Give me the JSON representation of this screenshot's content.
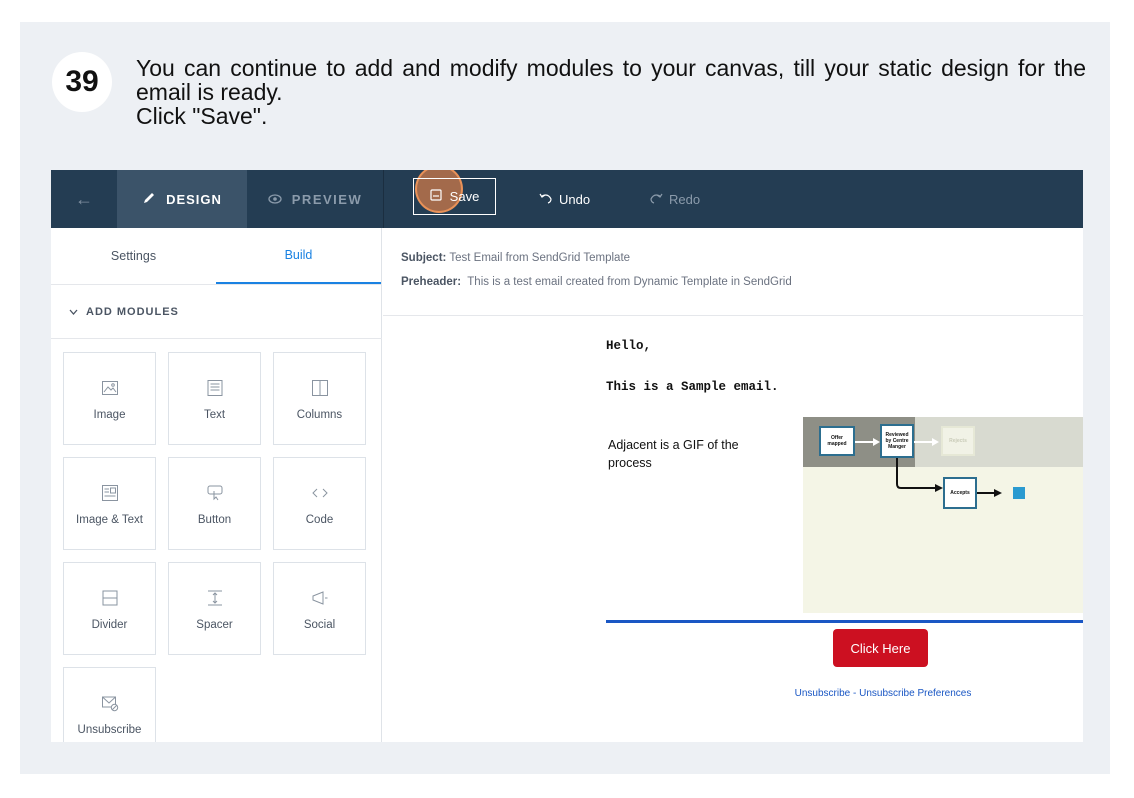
{
  "step": {
    "number": "39",
    "instruction_line1": "You can continue to add and modify modules to your canvas, till your static design for the email is ready.",
    "instruction_line2": "Click \"Save\"."
  },
  "topbar": {
    "design_label": "DESIGN",
    "preview_label": "PREVIEW",
    "save_label": "Save",
    "undo_label": "Undo",
    "redo_label": "Redo"
  },
  "sidebar": {
    "tabs": [
      "Settings",
      "Build"
    ],
    "active_tab": "Build",
    "section_label": "ADD MODULES",
    "modules": [
      {
        "label": "Image",
        "icon": "image-icon"
      },
      {
        "label": "Text",
        "icon": "text-icon"
      },
      {
        "label": "Columns",
        "icon": "columns-icon"
      },
      {
        "label": "Image & Text",
        "icon": "image-text-icon"
      },
      {
        "label": "Button",
        "icon": "button-icon"
      },
      {
        "label": "Code",
        "icon": "code-icon"
      },
      {
        "label": "Divider",
        "icon": "divider-icon"
      },
      {
        "label": "Spacer",
        "icon": "spacer-icon"
      },
      {
        "label": "Social",
        "icon": "social-icon"
      },
      {
        "label": "Unsubscribe",
        "icon": "unsubscribe-icon"
      }
    ]
  },
  "email": {
    "subject_label": "Subject:",
    "subject": "Test Email from SendGrid Template",
    "preheader_label": "Preheader:",
    "preheader": "This is a test email created from Dynamic Template in SendGrid",
    "greeting": "Hello,",
    "body_line": "This is a Sample email.",
    "adjacent_text": "Adjacent is a GIF of the process",
    "gif_nodes": [
      "Offer mapped",
      "Reviewed by Centre Manger",
      "Rejects",
      "Accepts"
    ],
    "button_label": "Click Here",
    "footer_link": "Unsubscribe - Unsubscribe Preferences"
  },
  "colors": {
    "topbar": "#243d53",
    "accent": "#1a82e2",
    "cta": "#cc1021",
    "highlight": "#e88246"
  }
}
